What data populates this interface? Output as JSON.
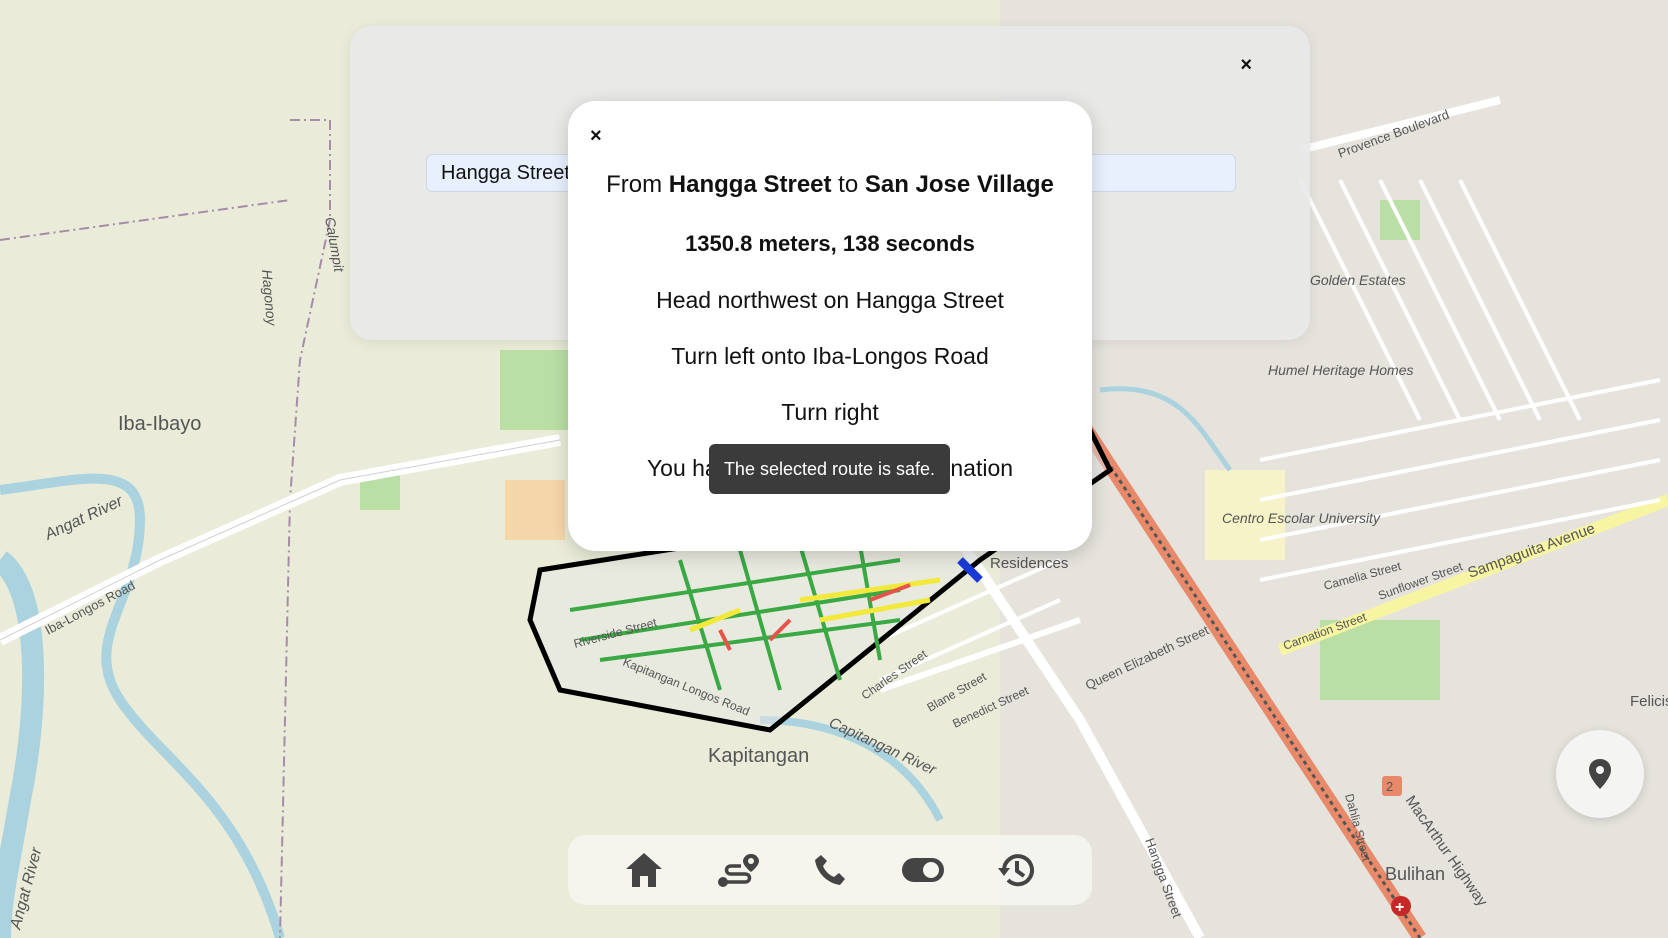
{
  "map": {
    "labels": {
      "iba_ibayo": "Iba-Ibayo",
      "kapitangan": "Kapitangan",
      "angat_river_1": "Angat River",
      "angat_river_2": "Angat River",
      "iba_longos_road": "Iba-Longos Road",
      "calumpit": "Calumpit",
      "hagonoy": "Hagonoy",
      "capitangan_river": "Capitangan River",
      "bulihan": "Bulihan",
      "sampaguita_avenue": "Sampaguita Avenue",
      "macarthur_highway": "MacArthur Highway",
      "centro_escolar": "Centro Escolar University",
      "humel_heritage": "Humel Heritage Homes",
      "provence_boulevard": "Provence Boulevard",
      "queen_elizabeth": "Queen Elizabeth Street",
      "residences": "Residences",
      "hangga_street": "Hangga Street",
      "riverside_street": "Riverside Street",
      "kapitangan_longos": "Kapitangan Longos Road",
      "carnation_street": "Carnation Street",
      "felicis_villa": "Felicis Villa",
      "camelia_street": "Camelia Street",
      "sunflower_street": "Sunflower Street",
      "charles_street": "Charles Street",
      "blane_street": "Blane Street",
      "benedict_street": "Benedict Street",
      "dahlia_street": "Dahlia Street",
      "golden_estates": "Golden Estates",
      "highway_shield": "2"
    }
  },
  "back_panel": {
    "close_icon": "×",
    "origin_value": "Hangga Street"
  },
  "route_modal": {
    "close_icon": "×",
    "title_from": "From ",
    "origin": "Hangga Street",
    "title_to": " to ",
    "destination": "San Jose Village",
    "summary": "1350.8 meters, 138 seconds",
    "steps": [
      "Head northwest on Hangga Street",
      "Turn left onto Iba-Longos Road",
      "Turn right",
      "You have arrived at your destination"
    ]
  },
  "toast": {
    "message": "The selected route is safe."
  },
  "bottom_nav": {
    "items": [
      "home-icon",
      "route-icon",
      "phone-icon",
      "toggle-icon",
      "history-icon"
    ]
  },
  "colors": {
    "route_boundary": "#000000",
    "safe_street": "#3aa843",
    "moderate_street": "#f2e93a",
    "unsafe_street": "#e5534b",
    "highway": "#e8896a",
    "water": "#aad3df"
  }
}
